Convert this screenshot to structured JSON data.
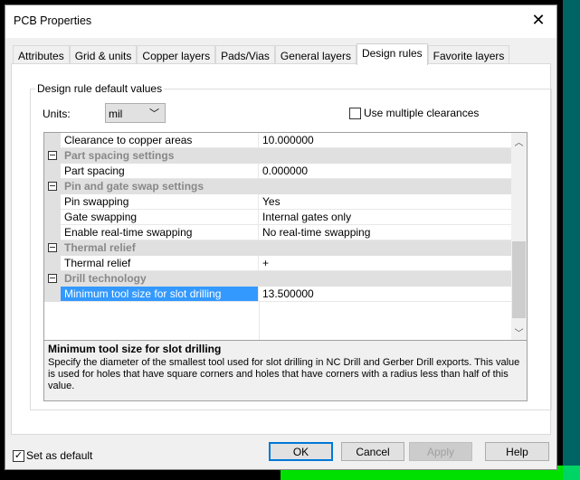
{
  "window": {
    "title": "PCB Properties",
    "close_icon": "close-icon"
  },
  "tabs": [
    {
      "label": "Attributes"
    },
    {
      "label": "Grid & units"
    },
    {
      "label": "Copper layers"
    },
    {
      "label": "Pads/Vias"
    },
    {
      "label": "General layers"
    },
    {
      "label": "Design rules",
      "active": true
    },
    {
      "label": "Favorite layers"
    }
  ],
  "group": {
    "label": "Design rule default values",
    "units_label": "Units:",
    "units_value": "mil",
    "multiple_clearances_label": "Use multiple clearances",
    "multiple_clearances_checked": false
  },
  "grid": {
    "rows": [
      {
        "type": "prop",
        "name": "Clearance to copper areas",
        "value": "10.000000"
      },
      {
        "type": "cat",
        "name": "Part spacing settings"
      },
      {
        "type": "prop",
        "name": "Part spacing",
        "value": "0.000000"
      },
      {
        "type": "cat",
        "name": "Pin and gate swap settings"
      },
      {
        "type": "prop",
        "name": "Pin swapping",
        "value": "Yes"
      },
      {
        "type": "prop",
        "name": "Gate swapping",
        "value": "Internal gates only"
      },
      {
        "type": "prop",
        "name": "Enable real-time swapping",
        "value": "No real-time swapping"
      },
      {
        "type": "cat",
        "name": "Thermal relief"
      },
      {
        "type": "prop",
        "name": "Thermal relief",
        "value": "+"
      },
      {
        "type": "cat",
        "name": "Drill technology"
      },
      {
        "type": "prop",
        "name": "Minimum tool size for slot drilling",
        "value": "13.500000",
        "selected": true
      }
    ],
    "selection_color": "#3399ff"
  },
  "description": {
    "title": "Minimum tool size for slot drilling",
    "text": "Specify the diameter of the smallest tool used for slot drilling in NC Drill and Gerber Drill exports. This value is used for holes that have square corners and holes that have corners with a radius less than half of this value."
  },
  "footer": {
    "set_default_label": "Set as default",
    "set_default_checked": true,
    "ok": "OK",
    "cancel": "Cancel",
    "apply": "Apply",
    "help": "Help"
  }
}
